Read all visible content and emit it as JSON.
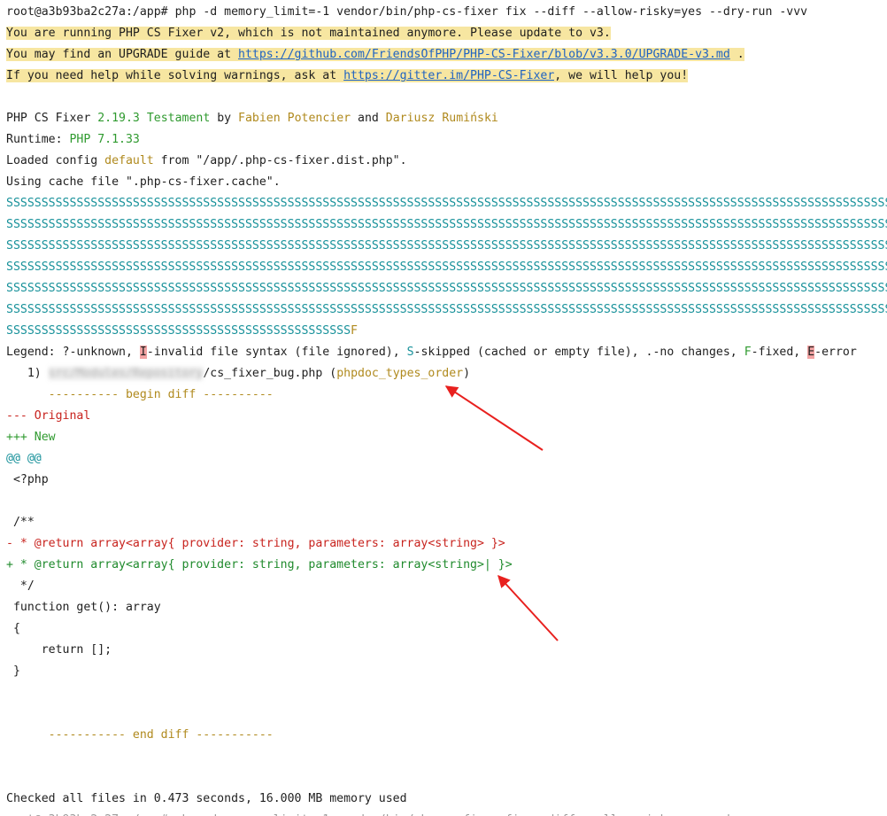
{
  "prompt": {
    "ps1": "root@a3b93ba2c27a:/app#",
    "command": " php -d memory_limit=-1 vendor/bin/php-cs-fixer fix --diff --allow-risky=yes --dry-run -vvv"
  },
  "notices": {
    "warning1": "You are running PHP CS Fixer v2, which is not maintained anymore. Please update to v3.",
    "warning2_prefix": "You may find an UPGRADE guide at ",
    "warning2_link": "https://github.com/FriendsOfPHP/PHP-CS-Fixer/blob/v3.3.0/UPGRADE-v3.md",
    "warning2_suffix": " .",
    "warning3_prefix": "If you need help while solving warnings, ask at ",
    "warning3_link": "https://gitter.im/PHP-CS-Fixer",
    "warning3_suffix": ", we will help you!"
  },
  "info": {
    "name_prefix": "PHP CS Fixer ",
    "version": "2.19.3",
    "codename": "Testament",
    "by": " by ",
    "author1": "Fabien Potencier",
    "and": " and ",
    "author2": "Dariusz Rumiński",
    "runtime_label": "Runtime: ",
    "runtime_value": "PHP 7.1.33",
    "config_prefix": "Loaded config ",
    "config_name": "default",
    "config_suffix": " from \"/app/.php-cs-fixer.dist.php\".",
    "cache": "Using cache file \".php-cs-fixer.cache\"."
  },
  "progress": {
    "lines": [
      "SSSSSSSSSSSSSSSSSSSSSSSSSSSSSSSSSSSSSSSSSSSSSSSSSSSSSSSSSSSSSSSSSSSSSSSSSSSSSSSSSSSSSSSSSSSSSSSSSSSSSSSSSSSSSSSSSSSSSSSSSSSSSSSSSS",
      "SSSSSSSSSSSSSSSSSSSSSSSSSSSSSSSSSSSSSSSSSSSSSSSSSSSSSSSSSSSSSSSSSSSSSSSSSSSSSSSSSSSSSSSSSSSSSSSSSSSSSSSSSSSSSSSSSSSSSSSSSSSSSSSSSSSS",
      "SSSSSSSSSSSSSSSSSSSSSSSSSSSSSSSSSSSSSSSSSSSSSSSSSSSSSSSSSSSSSSSSSSSSSSSSSSSSSSSSSSSSSSSSSSSSSSSSSSSSSSSSSSSSSSSSSSSSSSSSSSSSSSSSSS",
      "SSSSSSSSSSSSSSSSSSSSSSSSSSSSSSSSSSSSSSSSSSSSSSSSSSSSSSSSSSSSSSSSSSSSSSSSSSSSSSSSSSSSSSSSSSSSSSSSSSSSSSSSSSSSSSSSSSSSSSSSSSSSSSSSSSSS",
      "SSSSSSSSSSSSSSSSSSSSSSSSSSSSSSSSSSSSSSSSSSSSSSSSSSSSSSSSSSSSSSSSSSSSSSSSSSSSSSSSSSSSSSSSSSSSSSSSSSSSSSSSSSSSSSSSSSSSSSSSSSSSSSSSSS",
      "SSSSSSSSSSSSSSSSSSSSSSSSSSSSSSSSSSSSSSSSSSSSSSSSSSSSSSSSSSSSSSSSSSSSSSSSSSSSSSSSSSSSSSSSSSSSSSSSSSSSSSSSSSSSSSSSSSSSSSSSSSSSSSSSSS"
    ],
    "last_line_s": "SSSSSSSSSSSSSSSSSSSSSSSSSSSSSSSSSSSSSSSSSSSSSSSSS",
    "last_line_f": "F"
  },
  "legend": {
    "label": "Legend: ?-unknown, ",
    "i_key": "I",
    "i_text": "-invalid file syntax (file ignored), ",
    "s_key": "S",
    "s_text": "-skipped (cached or empty file), .-no changes, ",
    "f_key": "F",
    "f_text": "-fixed, ",
    "e_key": "E",
    "e_text": "-error"
  },
  "result": {
    "index": "   1) ",
    "path_blurred": "src/Modules/Repository",
    "filename": "/cs_fixer_bug.php",
    "rule_open": " (",
    "rule": "phpdoc_types_order",
    "rule_close": ")"
  },
  "diff": {
    "begin": "      ---------- begin diff ----------",
    "original": "--- Original",
    "new": "+++ New",
    "hunk": "@@ @@",
    "lines": [
      " <?php",
      "",
      " /**"
    ],
    "removed": "- * @return array<array{ provider: string, parameters: array<string> }>",
    "added": "+ * @return array<array{ provider: string, parameters: array<string>| }>",
    "tail": [
      "  */",
      " function get(): array",
      " {",
      "     return [];",
      " }"
    ],
    "end": "      ----------- end diff -----------"
  },
  "summary": {
    "checked": "Checked all files in 0.473 seconds, 16.000 MB memory used"
  },
  "colors": {
    "highlight": "#f7e6a1",
    "arrow": "#e8201e",
    "link": "#1f63c2"
  }
}
